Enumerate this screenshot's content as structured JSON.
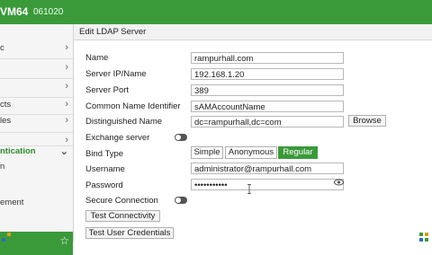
{
  "topbar": {
    "model": "VM64",
    "serial": "061020"
  },
  "sidebar": {
    "items": [
      {
        "label": "c",
        "chevron": "›"
      },
      {
        "label": "",
        "chevron": "›"
      },
      {
        "label": "",
        "chevron": "›"
      },
      {
        "label": "cts",
        "chevron": "›"
      },
      {
        "label": "les",
        "chevron": "›"
      },
      {
        "label": "",
        "chevron": "›"
      },
      {
        "label": "ntication",
        "chevron": "⌄"
      },
      {
        "label": "n",
        "chevron": ""
      },
      {
        "label": "ement",
        "chevron": ""
      }
    ]
  },
  "header": {
    "title": "Edit LDAP Server"
  },
  "form": {
    "name_label": "Name",
    "name_value": "rampurhall.com",
    "server_ip_label": "Server IP/Name",
    "server_ip_value": "192.168.1.20",
    "server_port_label": "Server Port",
    "server_port_value": "389",
    "cn_label": "Common Name Identifier",
    "cn_value": "sAMAccountName",
    "dn_label": "Distinguished Name",
    "dn_value": "dc=rampurhall,dc=com",
    "browse_label": "Browse",
    "exchange_label": "Exchange server",
    "bind_type_label": "Bind Type",
    "bind_options": [
      "Simple",
      "Anonymous",
      "Regular"
    ],
    "bind_selected": "Regular",
    "username_label": "Username",
    "username_value": "administrator@rampurhall.com",
    "password_label": "Password",
    "password_value": "•••••••••••",
    "secure_label": "Secure Connection",
    "test_connectivity_label": "Test Connectivity",
    "test_credentials_label": "Test User Credentials"
  },
  "icons": {
    "toggle": "toggle-switch-icon",
    "eye": "eye-icon",
    "star": "star-icon",
    "cursor": "text-cursor-icon",
    "corner": "dots-grid-icon"
  },
  "colors": {
    "accent": "#3a9a3a",
    "auth_text": "#2e8b2e"
  }
}
